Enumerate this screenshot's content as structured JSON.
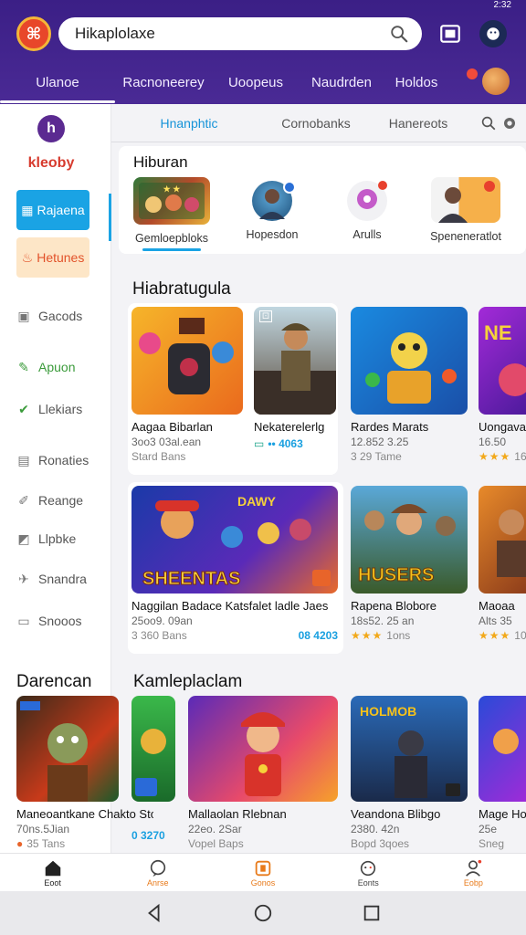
{
  "status_bar": {
    "left_text": "",
    "right_text": "2:32"
  },
  "header": {
    "search_value": "Hikaplolaxe",
    "tabs": [
      "Ulanoe",
      "Racnoneerey",
      "Uoopeus",
      "Naudrden",
      "Holdos"
    ]
  },
  "sidebar": {
    "brand": "kleoby",
    "buttons": [
      {
        "label": "Rajaena",
        "icon": "grid-icon"
      },
      {
        "label": "Hetunes",
        "icon": "fire-icon"
      }
    ],
    "items": [
      {
        "label": "Gacods",
        "icon": "box-icon"
      },
      {
        "label": "Apuon",
        "icon": "leaf-icon"
      },
      {
        "label": "Llekiars",
        "icon": "check-icon"
      },
      {
        "label": "Ronaties",
        "icon": "calendar-icon"
      },
      {
        "label": "Reange",
        "icon": "pencil-icon"
      },
      {
        "label": "Llpbke",
        "icon": "bookmark-icon"
      },
      {
        "label": "Snandra",
        "icon": "plane-icon"
      },
      {
        "label": "Snooos",
        "icon": "card-icon"
      }
    ],
    "section_title": "Darencan"
  },
  "subtabs": [
    "Hnanphtic",
    "Cornobanks",
    "Hanereots"
  ],
  "categories": {
    "title": "Hiburan",
    "items": [
      "Gemloepbloks",
      "Hopesdon",
      "Arulls",
      "Speneneratlot"
    ]
  },
  "section2": {
    "title": "Hiabratugula",
    "games": [
      {
        "title": "Aagaa Bibarlan",
        "sub": "3oo3 03al.ean",
        "meta": "Stard Bans"
      },
      {
        "title": "Nekaterelerlg",
        "sub": "",
        "meta": "•• 4063"
      },
      {
        "title": "Rardes Marats",
        "sub": "12.852 3.25",
        "meta": "3 29 Tame"
      },
      {
        "title": "Uongava",
        "sub": "16.50",
        "meta": "16"
      }
    ],
    "games_row2": [
      {
        "title": "Naggilan Badace Katsfalet ladle Jaes",
        "sub": "25oo9. 09an",
        "meta": "3 360 Bans",
        "tag": "08 4203",
        "banner": "SHEENTAS"
      },
      {
        "title": "Rapena Blobore",
        "sub": "18s52. 25 an",
        "meta": "1ons",
        "banner": "HUSERS"
      },
      {
        "title": "Maoaa",
        "sub": "Alts 35",
        "meta": "10"
      }
    ]
  },
  "section3": {
    "title": "Kamleplaclam",
    "games": [
      {
        "title": "Maneoantkane Chakto Stoft",
        "sub": "70ns.5Jian",
        "meta": "35 Tans"
      },
      {
        "title": "",
        "sub": "",
        "meta": "0 3270"
      },
      {
        "title": "Mallaolan Rlebnan",
        "sub": "22eo. 2Sar",
        "meta": "Vopel Baps"
      },
      {
        "title": "Veandona Blibgo",
        "sub": "2380. 42n",
        "meta": "Bopd 3qoes"
      },
      {
        "title": "Mage Ho",
        "sub": "25e",
        "meta": "Sneg"
      }
    ]
  },
  "bottom_nav": [
    "Eoot",
    "Anrse",
    "Gonos",
    "Eonts",
    "Eobp"
  ],
  "colors": {
    "header": "#3b1f86",
    "accent_blue": "#1aa3e4",
    "accent_orange": "#e87a1a"
  }
}
